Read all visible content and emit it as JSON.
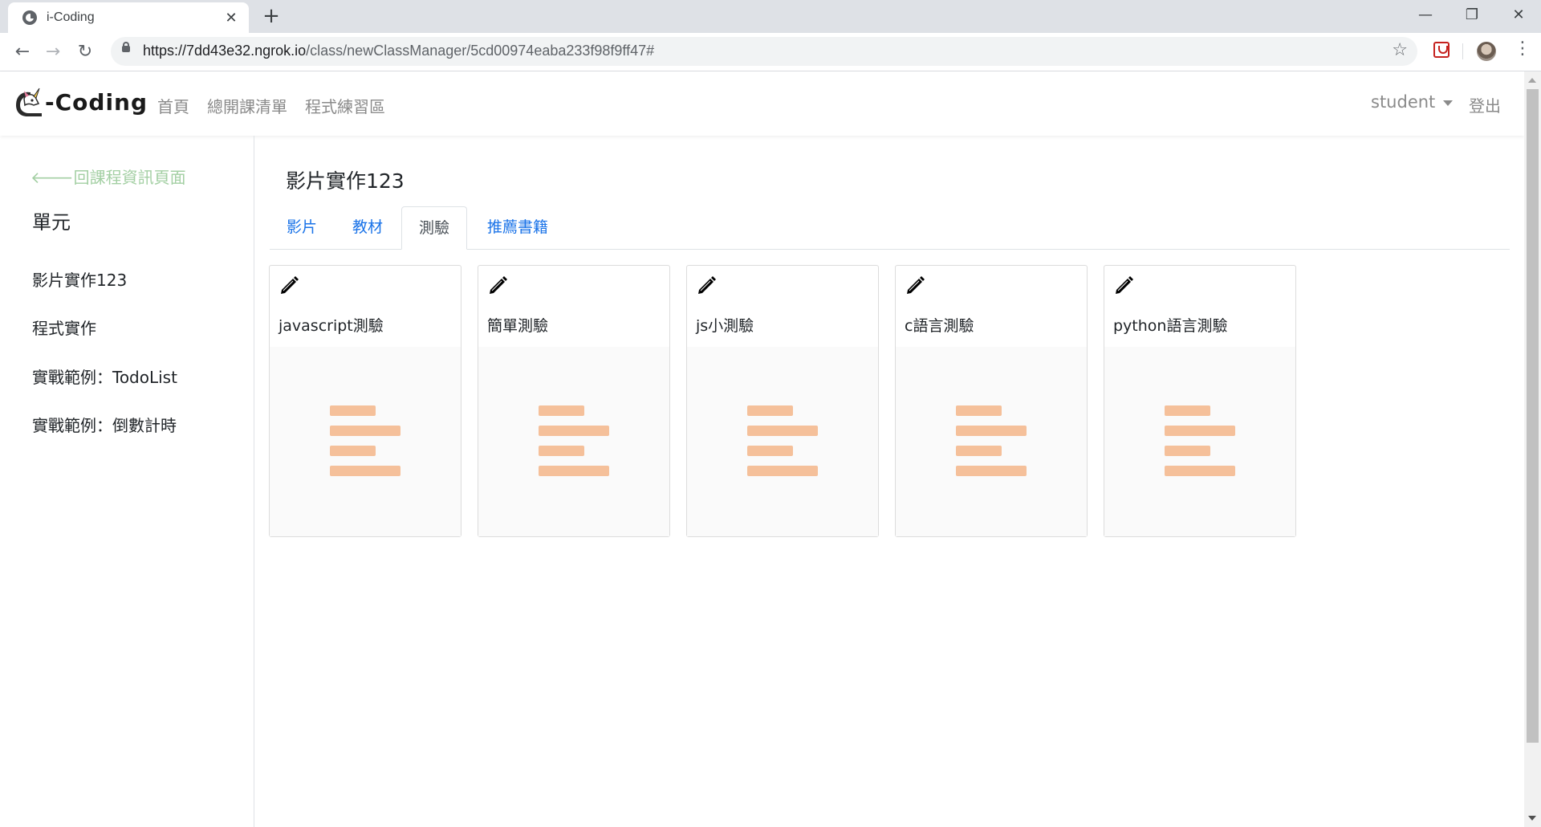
{
  "browser": {
    "tab_title": "i-Coding",
    "tab_close": "✕",
    "new_tab": "+",
    "url_host": "https://7dd43e32.ngrok.io",
    "url_path": "/class/newClassManager/5cd00974eaba233f98f9ff47#",
    "window_minimize": "—",
    "window_restore": "❐",
    "window_close": "✕"
  },
  "navbar": {
    "brand": "-Coding",
    "links": [
      "首頁",
      "總開課清單",
      "程式練習區"
    ],
    "user": "student",
    "logout": "登出"
  },
  "sidebar": {
    "back_link": "回課程資訊頁面",
    "heading": "單元",
    "units": [
      "影片實作123",
      "程式實作",
      "實戰範例：TodoList",
      "實戰範例：倒數計時"
    ]
  },
  "main": {
    "title": "影片實作123",
    "tabs": [
      "影片",
      "教材",
      "測驗",
      "推薦書籍"
    ],
    "active_tab": "測驗",
    "quizzes": [
      "javascript測驗",
      "簡單測驗",
      "js小測驗",
      "c語言測驗",
      "python語言測驗"
    ]
  },
  "colors": {
    "accent_link": "#1a73e8",
    "back_link": "#a3cfa3",
    "placeholder_bars": "#f5c09a"
  }
}
